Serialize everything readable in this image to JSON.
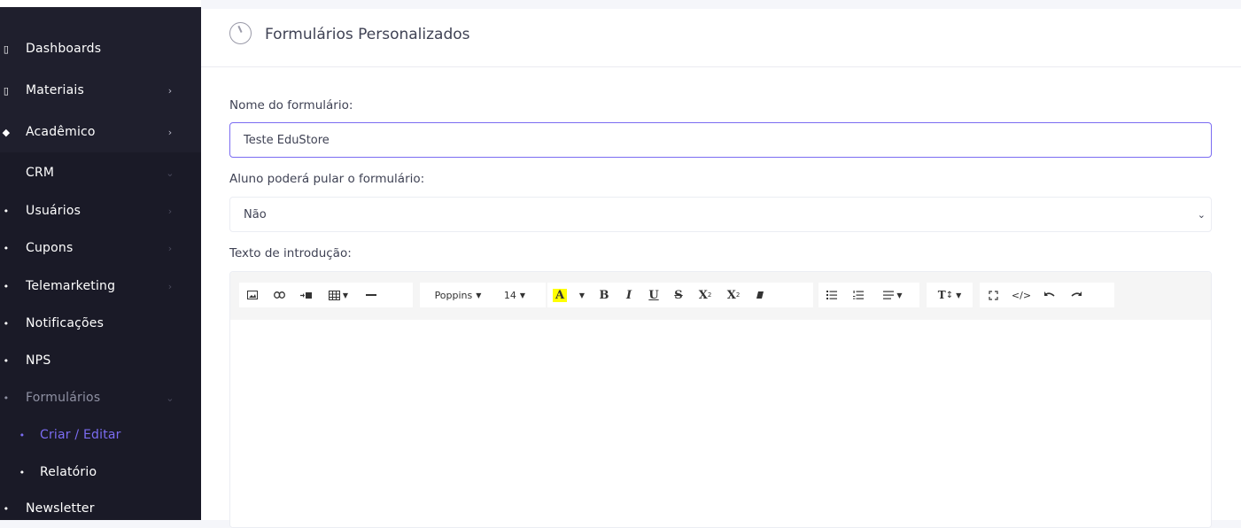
{
  "sidebar": {
    "items": [
      {
        "label": "Dashboards",
        "lead": "▯",
        "chevron": ""
      },
      {
        "label": "Materiais",
        "lead": "▯",
        "chevron": "›"
      },
      {
        "label": "Acadêmico",
        "lead": "◆",
        "chevron": "›"
      },
      {
        "label": "CRM",
        "lead": "",
        "chevron": "⌄"
      },
      {
        "label": "Usuários",
        "lead": "•",
        "chevron": "›"
      },
      {
        "label": "Cupons",
        "lead": "•",
        "chevron": "›"
      },
      {
        "label": "Telemarketing",
        "lead": "•",
        "chevron": "›"
      },
      {
        "label": "Notificações",
        "lead": "•",
        "chevron": ""
      },
      {
        "label": "NPS",
        "lead": "•",
        "chevron": ""
      },
      {
        "label": "Formulários",
        "lead": "•",
        "chevron": "⌄"
      },
      {
        "label": "Criar / Editar",
        "lead": "•",
        "chevron": ""
      },
      {
        "label": "Relatório",
        "lead": "•",
        "chevron": ""
      },
      {
        "label": "Newsletter",
        "lead": "•",
        "chevron": ""
      }
    ]
  },
  "header": {
    "title": "Formulários Personalizados",
    "icon": "timer-icon"
  },
  "form": {
    "name_label": "Nome do formulário:",
    "name_value": "Teste EduStore",
    "skip_label": "Aluno poderá pular o formulário:",
    "skip_value": "Não",
    "intro_label": "Texto de introdução:"
  },
  "toolbar": {
    "font_family": "Poppins",
    "font_size": "14",
    "bold": "B",
    "italic": "I",
    "underline": "U",
    "strike": "S",
    "superscript": "X",
    "subscript": "X",
    "highlight": "A",
    "code": "</>",
    "textsize": "T"
  },
  "colors": {
    "accent": "#7b6cf2",
    "sidebar_bg": "#1f1f2d",
    "highlight": "#ffff00"
  }
}
